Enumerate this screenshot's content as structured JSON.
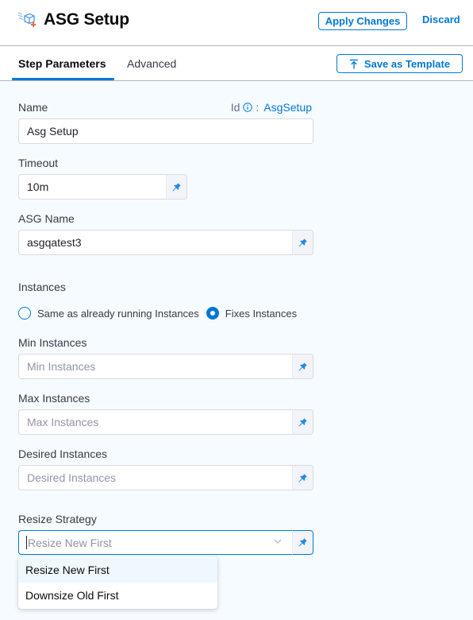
{
  "header": {
    "title": "ASG Setup",
    "apply_label": "Apply Changes",
    "discard_label": "Discard"
  },
  "tabs": {
    "items": [
      {
        "label": "Step Parameters",
        "active": true
      },
      {
        "label": "Advanced",
        "active": false
      }
    ],
    "save_template_label": "Save as Template"
  },
  "form": {
    "name": {
      "label": "Name",
      "value": "Asg Setup"
    },
    "id": {
      "label": "Id",
      "separator": ":",
      "value": "AsgSetup"
    },
    "timeout": {
      "label": "Timeout",
      "value": "10m"
    },
    "asg_name": {
      "label": "ASG Name",
      "value": "asgqatest3"
    },
    "instances": {
      "label": "Instances",
      "options": [
        {
          "label": "Same as already running Instances",
          "checked": false
        },
        {
          "label": "Fixes Instances",
          "checked": true
        }
      ]
    },
    "min_instances": {
      "label": "Min Instances",
      "placeholder": "Min Instances",
      "value": ""
    },
    "max_instances": {
      "label": "Max Instances",
      "placeholder": "Max Instances",
      "value": ""
    },
    "desired_instances": {
      "label": "Desired Instances",
      "placeholder": "Desired Instances",
      "value": ""
    },
    "resize_strategy": {
      "label": "Resize Strategy",
      "placeholder": "Resize New First",
      "options": [
        "Resize New First",
        "Downsize Old First"
      ],
      "highlighted_option": "Resize New First"
    }
  },
  "colors": {
    "accent": "#0278d5",
    "content_bg": "#f6fbff",
    "border": "#d9dae5",
    "logo_orange": "#f26b38"
  },
  "icons": {
    "logo": "asg-box-icon",
    "pin": "pin-icon",
    "info": "info-icon",
    "chevron": "chevron-down-icon",
    "upload": "upload-arrow-icon"
  }
}
